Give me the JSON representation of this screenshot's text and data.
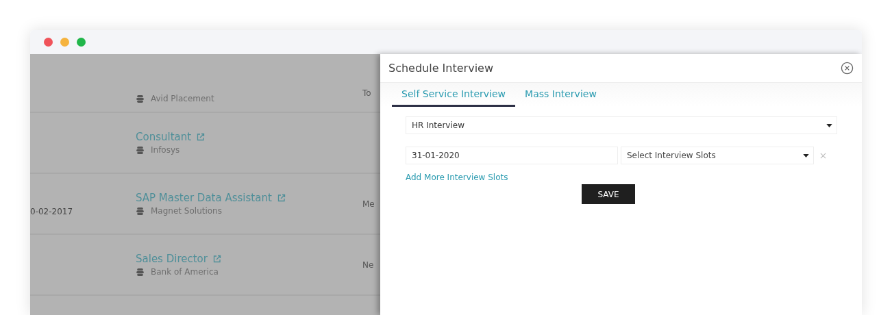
{
  "list_rows": [
    {
      "title": "",
      "company": "Avid Placement",
      "date": "",
      "column_3": "To"
    },
    {
      "title": "Consultant",
      "company": "Infosys",
      "date": "",
      "column_3": ""
    },
    {
      "title": "SAP Master Data Assistant",
      "company": "Magnet Solutions",
      "date": "0-02-2017",
      "column_3": "Me"
    },
    {
      "title": "Sales Director",
      "company": "Bank of America",
      "date": "",
      "column_3": "Ne"
    }
  ],
  "panel": {
    "title": "Schedule Interview",
    "tabs": [
      {
        "label": "Self Service Interview",
        "selected": true
      },
      {
        "label": "Mass Interview",
        "selected": false
      }
    ],
    "interview_type": {
      "value": "HR Interview"
    },
    "date_field": {
      "value": "31-01-2020"
    },
    "slots_field": {
      "placeholder": "Select Interview Slots"
    },
    "add_link": "Add More Interview Slots",
    "save_button": "SAVE"
  }
}
